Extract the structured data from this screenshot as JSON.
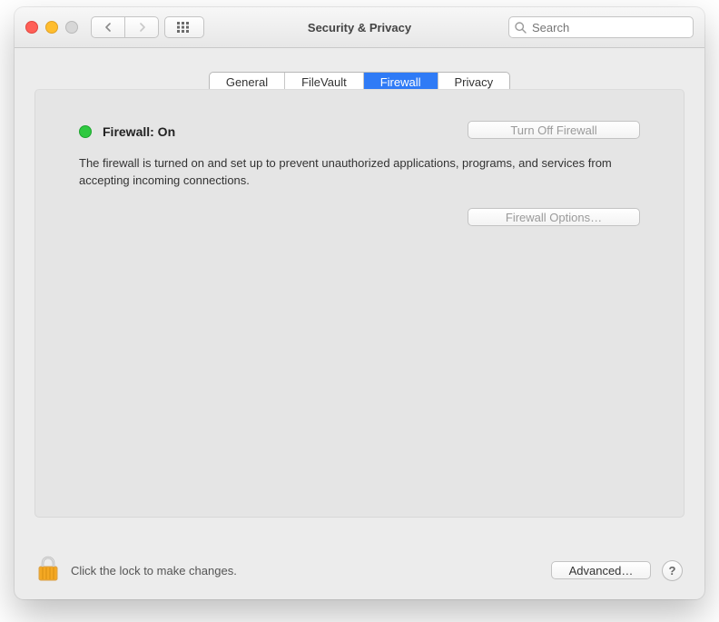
{
  "window": {
    "title": "Security & Privacy"
  },
  "search": {
    "placeholder": "Search"
  },
  "tabs": [
    {
      "label": "General",
      "active": false
    },
    {
      "label": "FileVault",
      "active": false
    },
    {
      "label": "Firewall",
      "active": true
    },
    {
      "label": "Privacy",
      "active": false
    }
  ],
  "firewall": {
    "status_label": "Firewall: On",
    "status_color": "#2fc940",
    "description": "The firewall is turned on and set up to prevent unauthorized applications, programs, and services from accepting incoming connections.",
    "turn_off_label": "Turn Off Firewall",
    "options_label": "Firewall Options…"
  },
  "footer": {
    "lock_hint": "Click the lock to make changes.",
    "advanced_label": "Advanced…",
    "help_label": "?"
  }
}
